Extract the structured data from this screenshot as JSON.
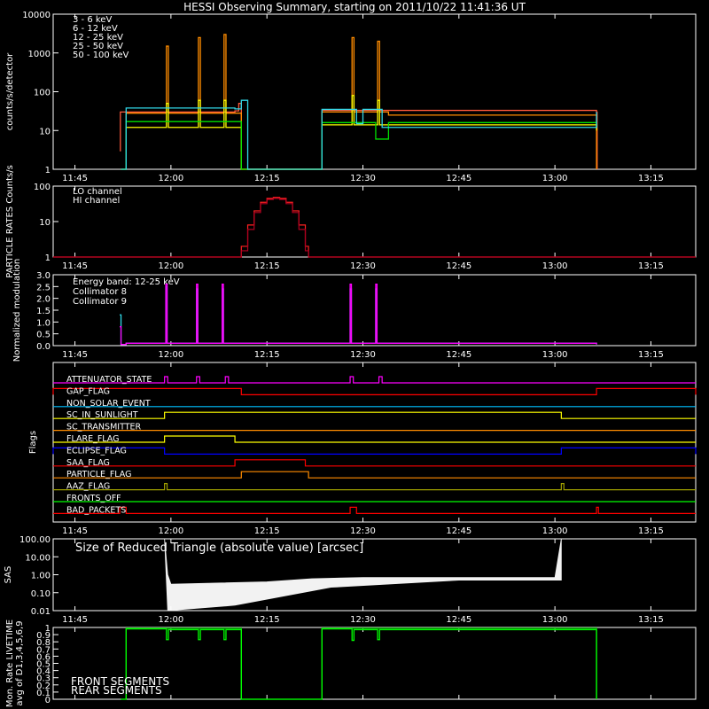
{
  "title": "HESSI Observing Summary, starting on 2011/10/22 11:41:36 UT",
  "time_ticks": [
    "11:45",
    "12:00",
    "12:15",
    "12:30",
    "12:45",
    "13:00",
    "13:15"
  ],
  "colors": {
    "e3_6": "#ff5a3c",
    "e6_12": "#ff8c00",
    "e12_25": "#ffff00",
    "e25_50": "#00e000",
    "e50_100": "#30d8e8",
    "lo": "#ff2020",
    "hi": "#b00020",
    "coll8": "#30d8e8",
    "coll9": "#ff00ff",
    "front": "#00ff00",
    "rear": "#00b000"
  },
  "chart_data": [
    {
      "type": "line",
      "ylabel": "counts/s/detector",
      "yscale": "log",
      "ylim": [
        1,
        10000
      ],
      "yticks": [
        "1",
        "10",
        "100",
        "1000",
        "10000"
      ],
      "xlim": [
        "11:41:36",
        "13:22"
      ],
      "series": [
        {
          "name": "3 - 6 keV",
          "x": [
            "11:52",
            "11:52.1",
            "12:10",
            "12:10.6",
            "12:11",
            "12:23.5",
            "12:23.6",
            "13:06.5",
            "13:06.6"
          ],
          "values": [
            3,
            30,
            32,
            50,
            1,
            1,
            33,
            30,
            1
          ]
        },
        {
          "name": "6 - 12 keV",
          "x": [
            "11:52.2",
            "11:53",
            "11:59",
            "11:59.3",
            "11:59.6",
            "12:01",
            "12:04",
            "12:04.3",
            "12:04.6",
            "12:06",
            "12:08",
            "12:08.3",
            "12:08.6",
            "12:10",
            "12:11",
            "12:23.6",
            "12:28",
            "12:28.3",
            "12:28.6",
            "12:30",
            "12:32",
            "12:32.3",
            "12:32.6",
            "12:34",
            "13:06.5"
          ],
          "values": [
            1,
            28,
            28,
            1500,
            28,
            28,
            28,
            2500,
            28,
            28,
            28,
            3000,
            28,
            28,
            1,
            30,
            30,
            2500,
            30,
            30,
            30,
            2000,
            30,
            25,
            1
          ]
        },
        {
          "name": "12 - 25 keV",
          "x": [
            "11:52.2",
            "11:53",
            "11:59",
            "11:59.3",
            "11:59.6",
            "12:04",
            "12:04.3",
            "12:04.6",
            "12:08",
            "12:08.3",
            "12:08.6",
            "12:11",
            "12:23.6",
            "12:28",
            "12:28.3",
            "12:28.6",
            "12:32",
            "12:32.3",
            "12:32.6",
            "13:06.5"
          ],
          "values": [
            1,
            12,
            12,
            50,
            12,
            12,
            60,
            12,
            12,
            60,
            12,
            1,
            14,
            14,
            80,
            14,
            14,
            60,
            14,
            10
          ]
        },
        {
          "name": "25 - 50 keV",
          "x": [
            "11:52.2",
            "11:53",
            "12:10",
            "12:11",
            "12:23.6",
            "12:31",
            "12:32",
            "12:34",
            "13:06.5"
          ],
          "values": [
            1,
            17,
            17,
            1,
            16,
            16,
            6,
            16,
            12
          ]
        },
        {
          "name": "50 - 100 keV",
          "x": [
            "11:52.2",
            "11:53",
            "12:10",
            "12:11",
            "12:12",
            "12:23.6",
            "12:28",
            "12:29",
            "12:30",
            "12:32",
            "12:33",
            "13:06.5"
          ],
          "values": [
            1,
            38,
            36,
            60,
            1,
            35,
            35,
            15,
            35,
            35,
            12,
            30
          ]
        }
      ]
    },
    {
      "type": "line",
      "ylabel": "PARTICLE RATES Counts/s",
      "yscale": "log",
      "ylim": [
        1,
        100
      ],
      "yticks": [
        "1",
        "10",
        "100"
      ],
      "series": [
        {
          "name": "LO channel",
          "x": [
            "11:41.6",
            "12:10.5",
            "12:11",
            "12:12",
            "12:13",
            "12:14",
            "12:15",
            "12:16",
            "12:17",
            "12:18",
            "12:19",
            "12:20",
            "12:21",
            "12:21.5",
            "13:22"
          ],
          "values": [
            1,
            1,
            2,
            8,
            20,
            35,
            45,
            48,
            45,
            35,
            20,
            8,
            2,
            1,
            1
          ]
        },
        {
          "name": "HI channel",
          "x": [
            "11:41.6",
            "12:10.5",
            "12:11",
            "12:12",
            "12:13",
            "12:14",
            "12:15",
            "12:16",
            "12:17",
            "12:18",
            "12:19",
            "12:20",
            "12:21",
            "12:21.5",
            "13:22"
          ],
          "values": [
            1,
            1,
            1.5,
            6,
            18,
            32,
            42,
            45,
            42,
            32,
            18,
            6,
            1.5,
            1,
            1
          ]
        }
      ]
    },
    {
      "type": "line",
      "ylabel": "Normalized modulation",
      "ylim": [
        0,
        3.0
      ],
      "yticks": [
        "0.0",
        "0.5",
        "1.0",
        "1.5",
        "2.0",
        "2.5",
        "3.0"
      ],
      "annotation": "Energy band: 12-25 keV",
      "series": [
        {
          "name": "Collimator 8",
          "x": [
            "11:52",
            "11:52.2",
            "11:53",
            "11:59.2",
            "11:59.4",
            "12:04",
            "12:04.2",
            "12:08",
            "12:08.2",
            "12:11",
            "12:23.5",
            "12:28",
            "12:28.2",
            "12:32",
            "12:32.2",
            "13:06.5"
          ],
          "values": [
            1.3,
            0.05,
            0.1,
            2.5,
            0.1,
            2.4,
            0.1,
            2.4,
            0.1,
            0.1,
            0.1,
            2.4,
            0.1,
            2.4,
            0.1,
            0.05
          ]
        },
        {
          "name": "Collimator 9",
          "x": [
            "11:52",
            "11:52.2",
            "11:53",
            "11:59.2",
            "11:59.4",
            "12:04",
            "12:04.2",
            "12:08",
            "12:08.2",
            "12:11",
            "12:23.5",
            "12:28",
            "12:28.2",
            "12:32",
            "12:32.2",
            "13:06.5"
          ],
          "values": [
            0.8,
            0.05,
            0.1,
            2.6,
            0.1,
            2.6,
            0.1,
            2.6,
            0.1,
            0.1,
            0.1,
            2.6,
            0.1,
            2.6,
            0.1,
            0.05
          ]
        }
      ]
    },
    {
      "type": "line",
      "ylabel": "Flags",
      "flags": [
        {
          "name": "ATTENUATOR_STATE",
          "color": "#ff00ff",
          "on": [
            [
              "11:59",
              "11:59.5"
            ],
            [
              "12:04",
              "12:04.5"
            ],
            [
              "12:08.5",
              "12:09"
            ],
            [
              "12:28",
              "12:28.5"
            ],
            [
              "12:32.5",
              "12:33"
            ]
          ]
        },
        {
          "name": "GAP_FLAG",
          "color": "#ff0000",
          "on": [
            [
              "11:41.6",
              "12:11"
            ],
            [
              "13:06.5",
              "13:22"
            ]
          ]
        },
        {
          "name": "NON_SOLAR_EVENT",
          "color": "#00c0ff",
          "on": []
        },
        {
          "name": "SC_IN_SUNLIGHT",
          "color": "#ffff00",
          "on": [
            [
              "11:59",
              "13:01"
            ]
          ]
        },
        {
          "name": "SC_TRANSMITTER",
          "color": "#ff8c00",
          "on": []
        },
        {
          "name": "FLARE_FLAG",
          "color": "#ffff00",
          "on": [
            [
              "11:59",
              "12:10"
            ]
          ]
        },
        {
          "name": "ECLIPSE_FLAG",
          "color": "#0000ff",
          "on": [
            [
              "11:41.6",
              "11:59"
            ],
            [
              "13:01",
              "13:22"
            ]
          ]
        },
        {
          "name": "SAA_FLAG",
          "color": "#ff0000",
          "on": [
            [
              "12:10",
              "12:21"
            ]
          ]
        },
        {
          "name": "PARTICLE_FLAG",
          "color": "#ff8c00",
          "on": [
            [
              "12:11",
              "12:21.5"
            ]
          ]
        },
        {
          "name": "AAZ_FLAG",
          "color": "#a0a000",
          "on": [
            [
              "11:59",
              "11:59.4"
            ],
            [
              "13:01",
              "13:01.4"
            ]
          ]
        },
        {
          "name": "FRONTS_OFF",
          "color": "#00ff00",
          "on": []
        },
        {
          "name": "BAD_PACKETS",
          "color": "#ff0000",
          "on": [
            [
              "11:52",
              "11:53"
            ],
            [
              "12:28",
              "12:29"
            ],
            [
              "13:06.5",
              "13:06.8"
            ]
          ]
        }
      ]
    },
    {
      "type": "line",
      "ylabel": "SAS",
      "yscale": "log",
      "ylim": [
        0.01,
        100
      ],
      "yticks": [
        "0.01",
        "0.10",
        "1.00",
        "10.00",
        "100.00"
      ],
      "annotation": "Size of Reduced Triangle (absolute value) [arcsec]",
      "series": [
        {
          "name": "SAS",
          "x": [
            "11:59",
            "11:59.5",
            "12:00",
            "12:15",
            "12:22",
            "12:30",
            "12:45",
            "13:00",
            "13:01",
            "13:01.5"
          ],
          "values": [
            100,
            1,
            0.3,
            0.4,
            0.6,
            0.7,
            0.7,
            0.7,
            100,
            0.01
          ]
        }
      ]
    },
    {
      "type": "line",
      "ylabel": "Mon. Rate LIVETIME avg of D1,3,4,5,6,9",
      "ylim": [
        0,
        1
      ],
      "yticks": [
        "0",
        "0.1",
        "0.2",
        "0.3",
        "0.4",
        "0.5",
        "0.6",
        "0.7",
        "0.8",
        "0.9",
        "1"
      ],
      "series": [
        {
          "name": "FRONT SEGMENTS",
          "x": [
            "11:52.2",
            "11:53",
            "11:59",
            "11:59.3",
            "11:59.6",
            "12:04",
            "12:04.3",
            "12:04.6",
            "12:08",
            "12:08.3",
            "12:08.6",
            "12:11",
            "12:23.6",
            "12:28",
            "12:28.3",
            "12:28.6",
            "12:32",
            "12:32.3",
            "12:32.6",
            "13:06.5"
          ],
          "values": [
            0,
            0.98,
            0.98,
            0.83,
            0.97,
            0.97,
            0.83,
            0.97,
            0.97,
            0.83,
            0.97,
            0,
            0.98,
            0.98,
            0.82,
            0.97,
            0.97,
            0.83,
            0.97,
            0
          ]
        },
        {
          "name": "REAR SEGMENTS",
          "x": [
            "11:52.2",
            "11:53",
            "12:11",
            "12:23.6",
            "13:06.5"
          ],
          "values": [
            0,
            0.99,
            0,
            0.99,
            0
          ]
        }
      ]
    }
  ]
}
